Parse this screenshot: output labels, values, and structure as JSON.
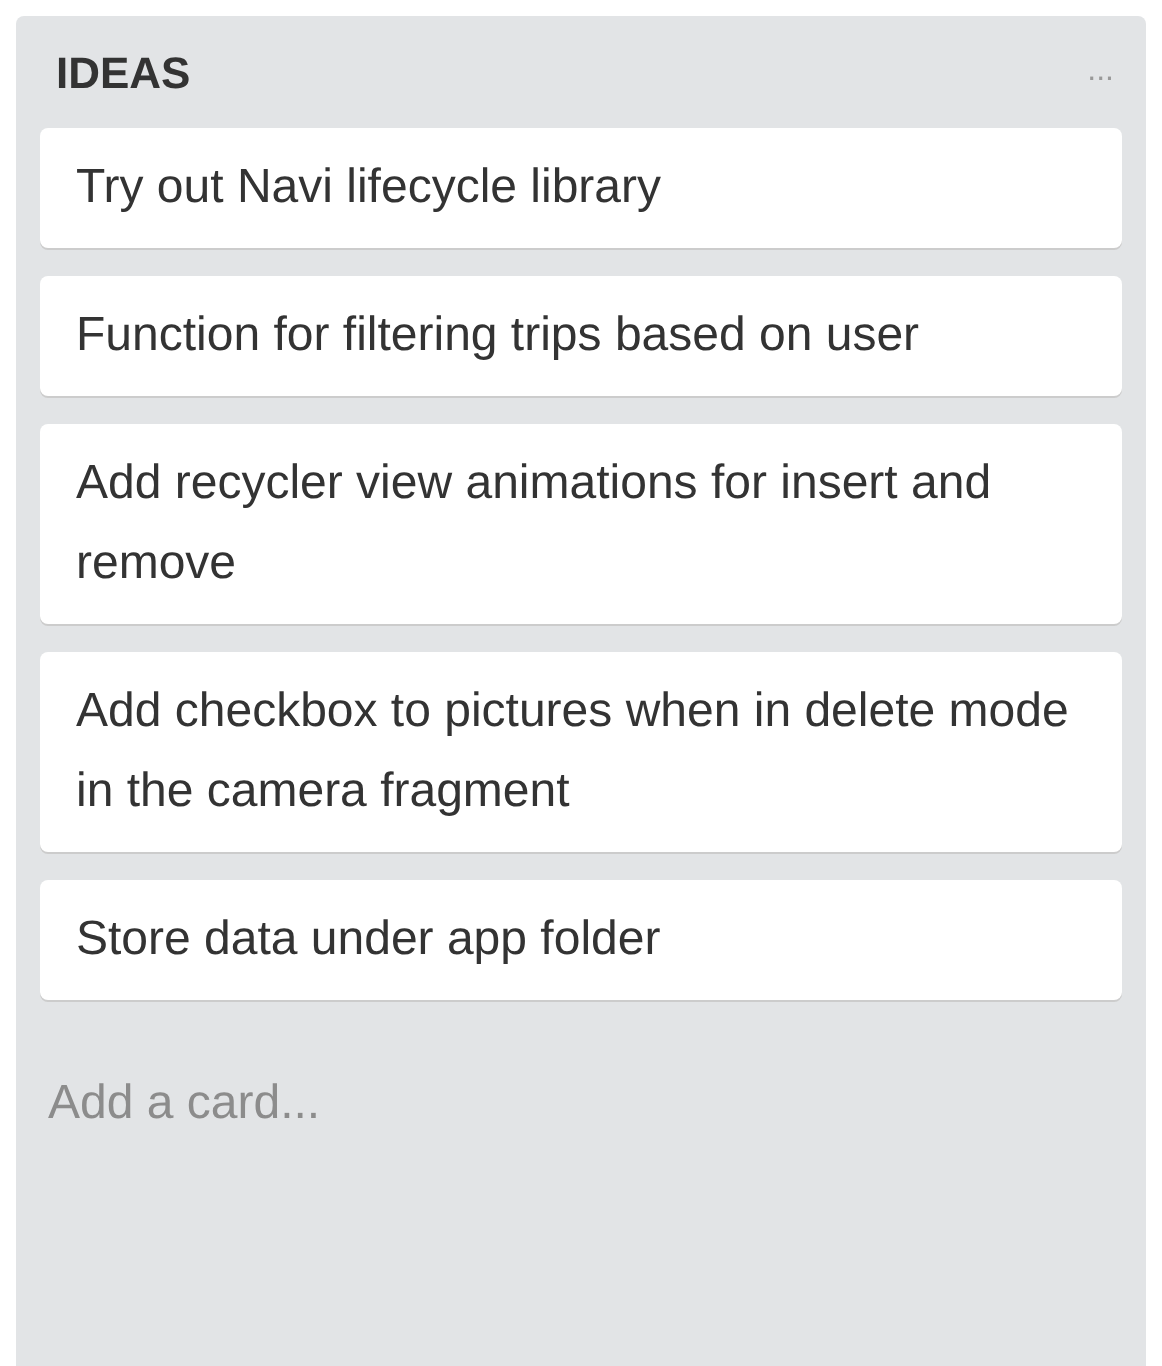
{
  "list": {
    "title": "IDEAS",
    "menu": "...",
    "cards": [
      {
        "text": "Try out Navi lifecycle library"
      },
      {
        "text": "Function for filtering trips based on user"
      },
      {
        "text": "Add recycler view animations for insert and remove"
      },
      {
        "text": "Add checkbox to pictures when in delete mode in the camera fragment"
      },
      {
        "text": "Store data under app folder"
      }
    ],
    "add_card": "Add a card..."
  }
}
